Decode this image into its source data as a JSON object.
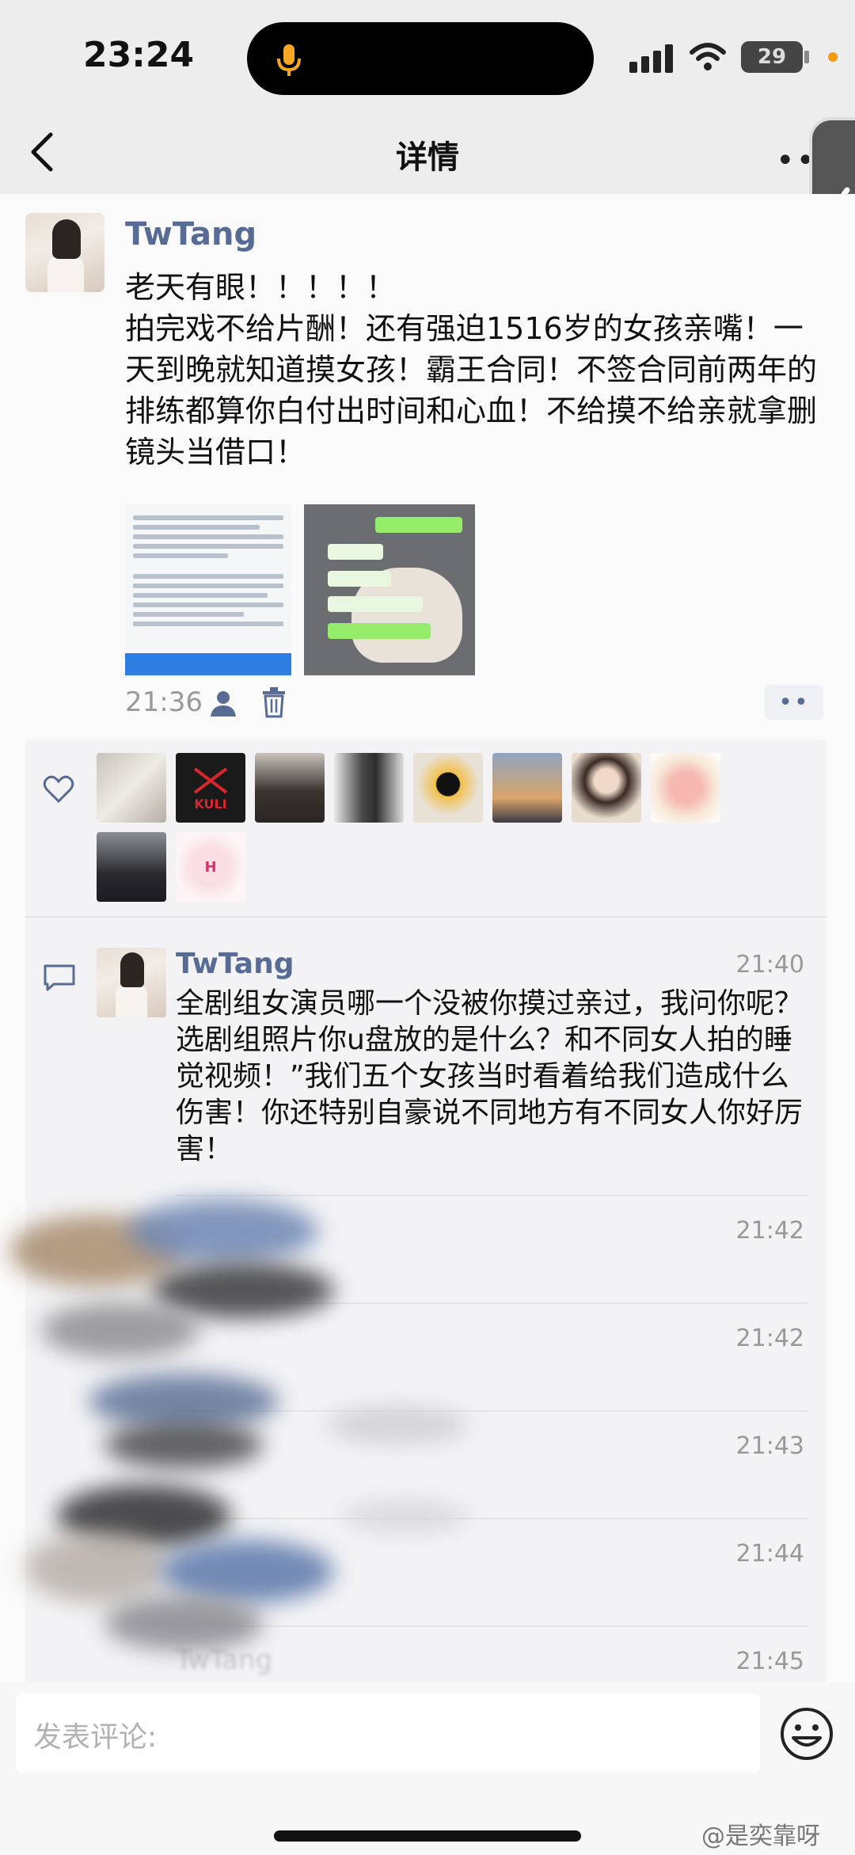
{
  "status_bar": {
    "time": "23:24",
    "battery": "29"
  },
  "nav": {
    "title": "详情"
  },
  "post": {
    "author": "TwTang",
    "text": "老天有眼！！！！！\n拍完戏不给片酬！还有强迫1516岁的女孩亲嘴！一天到晚就知道摸女孩！霸王合同！不签合同前两年的排练都算你白付出时间和心血！不给摸不给亲就拿删镜头当借口！",
    "time": "21:36"
  },
  "comments": [
    {
      "author": "TwTang",
      "time": "21:40",
      "text": "全剧组女演员哪一个没被你摸过亲过，我问你呢？选剧组照片你u盘放的是什么？和不同女人拍的睡觉视频！”我们五个女孩当时看着给我们造成什么伤害！你还特别自豪说不同地方有不同女人你好厉害！"
    },
    {
      "author": "",
      "time": "21:42",
      "text": ""
    },
    {
      "author": "",
      "time": "21:42",
      "text": ""
    },
    {
      "author": "",
      "time": "21:43",
      "text": ""
    },
    {
      "author": "",
      "time": "21:44",
      "text": ""
    },
    {
      "author": "TwTang",
      "time": "21:45",
      "text": ""
    }
  ],
  "likers_avatar_text": [
    "KULI",
    "H"
  ],
  "input": {
    "placeholder": "发表评论:"
  },
  "watermark": "@是奕靠呀",
  "colors": {
    "link_blue": "#576b95",
    "accent_orange": "#f39c12"
  }
}
